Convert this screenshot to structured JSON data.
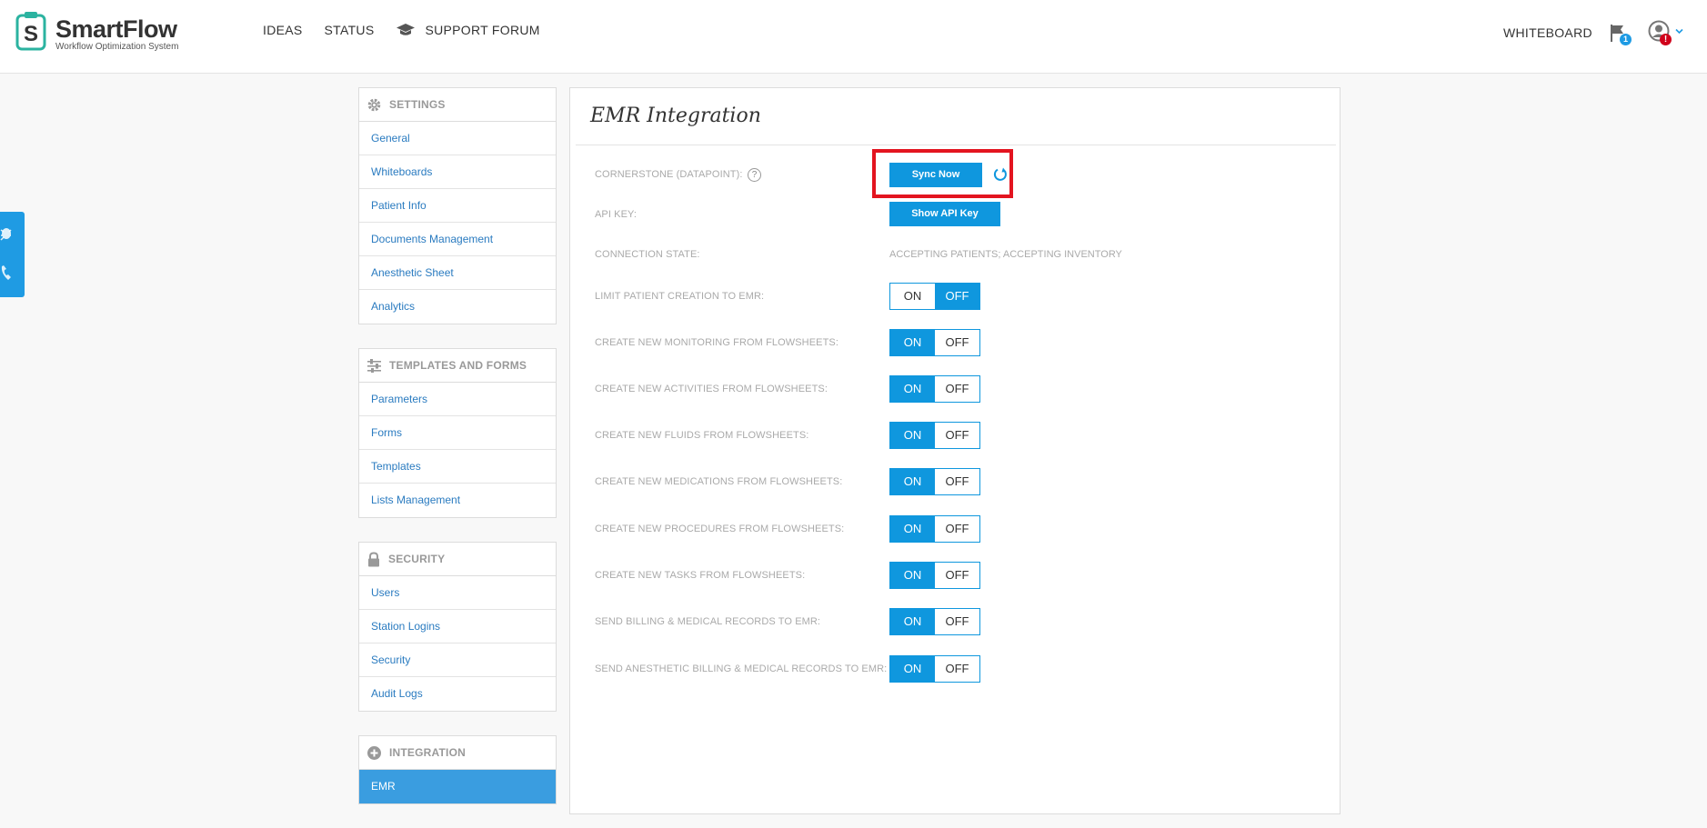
{
  "header": {
    "logo_name": "SmartFlow",
    "logo_tagline": "Workflow Optimization System",
    "nav": [
      "IDEAS",
      "STATUS",
      "SUPPORT FORUM"
    ],
    "whiteboard_label": "WHITEBOARD",
    "flag_count": "1",
    "user_alert": "!"
  },
  "sidebar": {
    "groups": [
      {
        "title": "SETTINGS",
        "icon": "gear-icon",
        "items": [
          "General",
          "Whiteboards",
          "Patient Info",
          "Documents Management",
          "Anesthetic Sheet",
          "Analytics"
        ]
      },
      {
        "title": "TEMPLATES AND FORMS",
        "icon": "sliders-icon",
        "items": [
          "Parameters",
          "Forms",
          "Templates",
          "Lists Management"
        ]
      },
      {
        "title": "SECURITY",
        "icon": "lock-icon",
        "items": [
          "Users",
          "Station Logins",
          "Security",
          "Audit Logs"
        ]
      },
      {
        "title": "INTEGRATION",
        "icon": "plus-circle-icon",
        "items": [
          "EMR"
        ],
        "active": "EMR"
      }
    ]
  },
  "main": {
    "title": "EMR Integration",
    "cornerstone_label": "CORNERSTONE (DATAPOINT):",
    "help_symbol": "?",
    "sync_label": "Sync Now",
    "api_key_label": "API KEY:",
    "api_button": "Show API Key",
    "connection_label": "CONNECTION STATE:",
    "connection_value": "ACCEPTING PATIENTS; ACCEPTING INVENTORY",
    "toggle_on": "ON",
    "toggle_off": "OFF",
    "toggles": [
      {
        "label": "LIMIT PATIENT CREATION TO EMR:",
        "state": "off"
      },
      {
        "label": "CREATE NEW MONITORING FROM FLOWSHEETS:",
        "state": "on"
      },
      {
        "label": "CREATE NEW ACTIVITIES FROM FLOWSHEETS:",
        "state": "on"
      },
      {
        "label": "CREATE NEW FLUIDS FROM FLOWSHEETS:",
        "state": "on"
      },
      {
        "label": "CREATE NEW MEDICATIONS FROM FLOWSHEETS:",
        "state": "on"
      },
      {
        "label": "CREATE NEW PROCEDURES FROM FLOWSHEETS:",
        "state": "on"
      },
      {
        "label": "CREATE NEW TASKS FROM FLOWSHEETS:",
        "state": "on"
      },
      {
        "label": "SEND BILLING & MEDICAL RECORDS TO EMR:",
        "state": "on"
      },
      {
        "label": "SEND ANESTHETIC BILLING & MEDICAL RECORDS TO EMR:",
        "state": "on"
      }
    ]
  },
  "colors": {
    "accent": "#0f97de",
    "sidebar_active": "#3a9de0",
    "highlight": "#e3141f",
    "link": "#2a7bc0"
  }
}
